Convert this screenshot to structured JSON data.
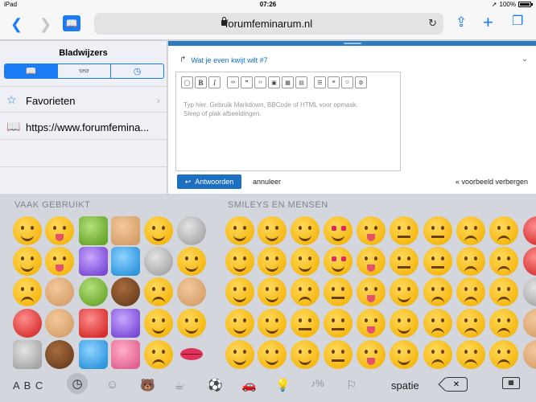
{
  "status": {
    "device": "iPad",
    "time": "07:26",
    "battery": "100%"
  },
  "toolbar": {
    "url": "forumfeminarum.nl"
  },
  "sidebar": {
    "title": "Bladwijzers",
    "segments": [
      "bookmarks-icon",
      "reading-list-icon",
      "history-icon"
    ],
    "items": [
      {
        "label": "Favorieten",
        "icon": "star-icon"
      },
      {
        "label": "https://www.forumfemina...",
        "icon": "book-icon"
      }
    ]
  },
  "content": {
    "reply_to": "Wat je even kwijt wilt #7",
    "placeholder_line1": "Typ hier. Gebruik Markdown, BBCode of HTML voor opmaak.",
    "placeholder_line2": "Sleep of plak afbeeldingen.",
    "submit_label": "Antwoorden",
    "cancel_label": "annuleer",
    "hide_preview_label": "« voorbeeld verbergen"
  },
  "keyboard": {
    "frequent_title": "VAAK GEBRUIKT",
    "smileys_title": "SMILEYS EN MENSEN",
    "abc_label": "A B C",
    "space_label": "spatie",
    "categories": [
      "clock-icon",
      "smiley-icon",
      "animal-icon",
      "food-icon",
      "ball-icon",
      "car-icon",
      "bulb-icon",
      "symbols-icon",
      "flag-icon"
    ]
  }
}
